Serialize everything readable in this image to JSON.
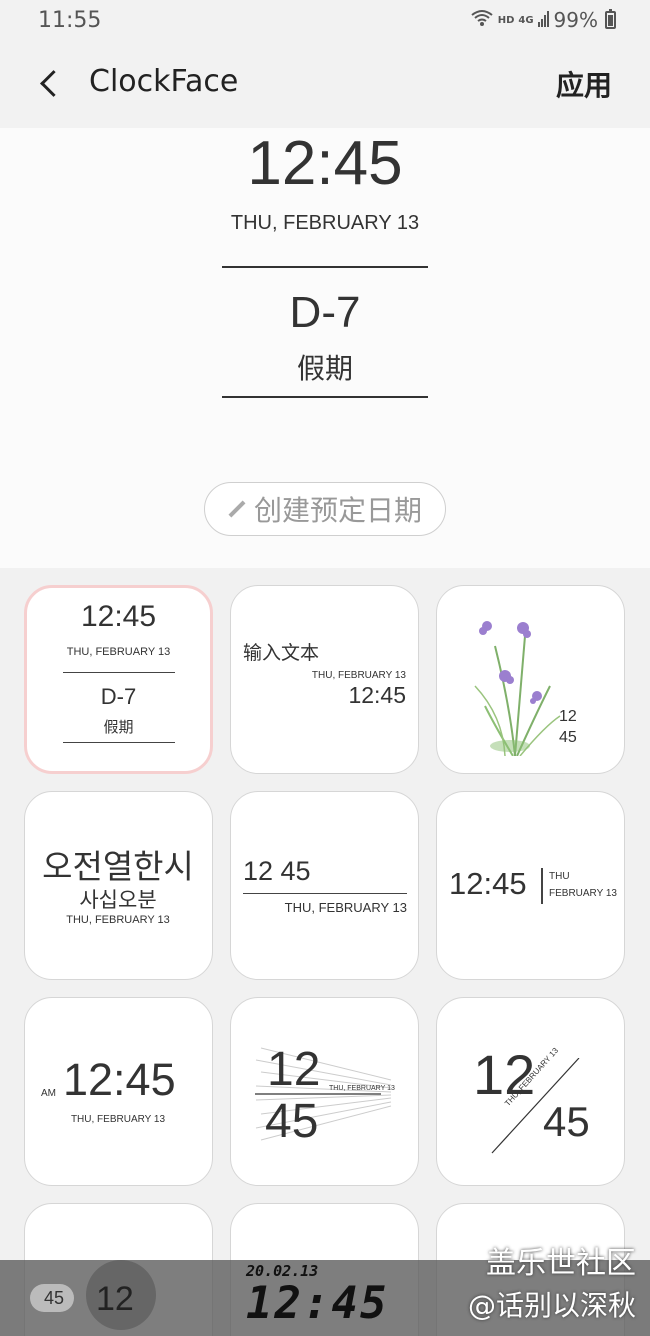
{
  "status": {
    "time": "11:55",
    "hd": "HD",
    "net": "4G",
    "battery": "99%"
  },
  "header": {
    "title": "ClockFace",
    "apply_label": "应用"
  },
  "preview": {
    "time": "12:45",
    "date": "THU, FEBRUARY 13",
    "dday": "D-7",
    "dday_label": "假期",
    "create_label": "创建预定日期"
  },
  "tiles": {
    "t1": {
      "time": "12:45",
      "date": "THU, FEBRUARY 13",
      "dday": "D-7",
      "label": "假期"
    },
    "t2": {
      "text": "输入文本",
      "date": "THU, FEBRUARY 13",
      "time": "12:45"
    },
    "t3": {
      "hour": "12",
      "minute": "45"
    },
    "t4": {
      "line1": "오전열한시",
      "line2": "사십오분",
      "date": "THU, FEBRUARY 13"
    },
    "t5": {
      "time": "12 45",
      "date": "THU, FEBRUARY 13"
    },
    "t6": {
      "time": "12:45",
      "day": "THU",
      "date": "FEBRUARY 13"
    },
    "t7": {
      "ampm": "AM",
      "time": "12:45",
      "date": "THU, FEBRUARY 13"
    },
    "t8": {
      "hour": "12",
      "minute": "45",
      "date": "THU, FEBRUARY 13"
    },
    "t9": {
      "hour": "12",
      "minute": "45",
      "date": "THU, FEBRUARY 13"
    }
  },
  "bottom": {
    "digital_date": "20.02.13",
    "digital_time": "12:45",
    "small": "45",
    "partial": "12"
  },
  "watermark": {
    "line1": "盖乐世社区",
    "line2": "@话别以深秋"
  }
}
